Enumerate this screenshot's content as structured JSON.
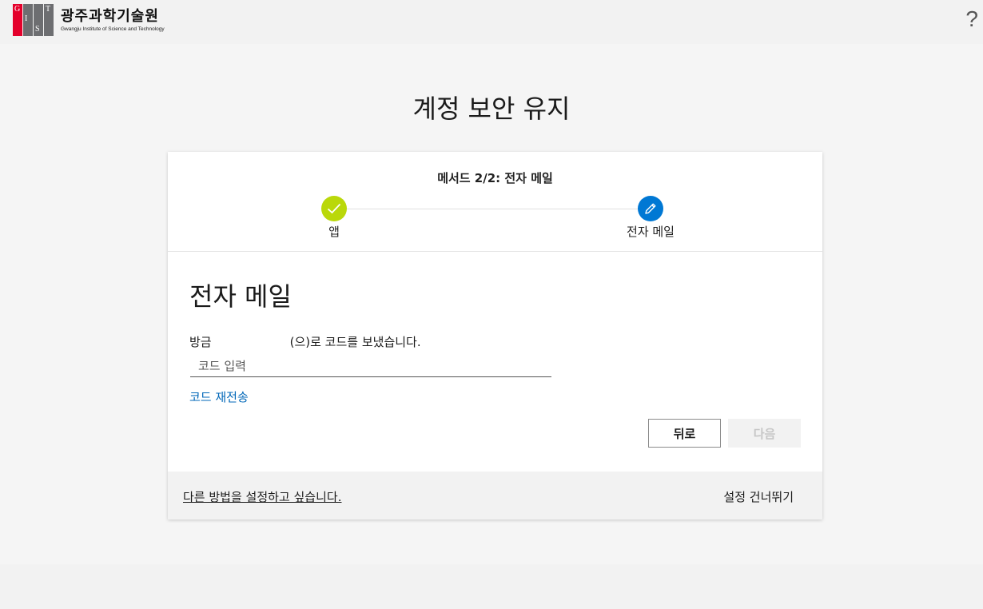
{
  "header": {
    "logo_letters": [
      "G",
      "I",
      "S",
      "T"
    ],
    "logo_name_ko": "광주과학기술원",
    "logo_name_en": "Gwangju Institute of Science and Technology",
    "help_label": "?"
  },
  "page": {
    "title": "계정 보안 유지"
  },
  "wizard": {
    "heading": "메서드 2/2: 전자 메일",
    "steps": [
      {
        "label": "앱",
        "status": "complete",
        "icon": "checkmark-icon"
      },
      {
        "label": "전자 메일",
        "status": "current",
        "icon": "pencil-icon"
      }
    ]
  },
  "email_step": {
    "section_title": "전자 메일",
    "sent_prefix": "방금",
    "sent_suffix": "(으)로 코드를 보냈습니다.",
    "code_placeholder": "코드 입력",
    "code_value": "",
    "resend_label": "코드 재전송",
    "back_label": "뒤로",
    "next_label": "다음"
  },
  "footer": {
    "other_method_label": "다른 방법을 설정하고 싶습니다.",
    "skip_label": "설정 건너뛰기"
  },
  "colors": {
    "accent_blue": "#0078d4",
    "link_blue": "#0067b8",
    "complete_green": "#bad80a",
    "logo_red": "#e4002b",
    "logo_gray": "#6d6e71"
  }
}
